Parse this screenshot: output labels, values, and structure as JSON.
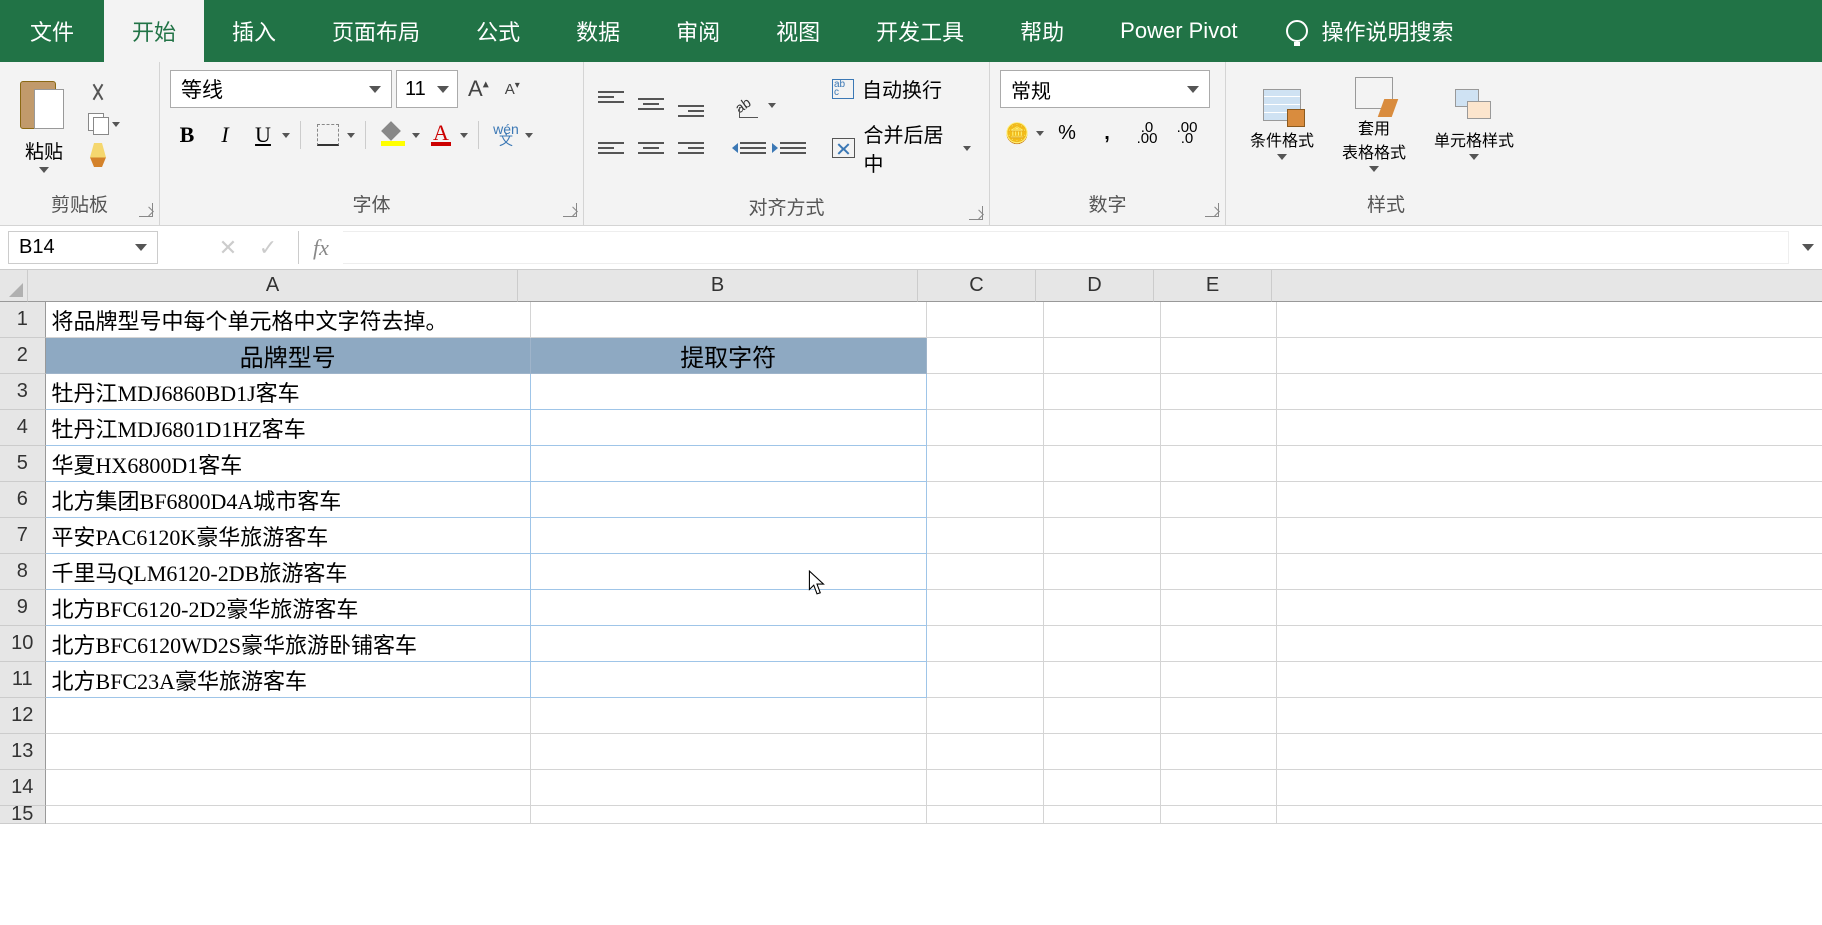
{
  "tabs": {
    "file": "文件",
    "home": "开始",
    "insert": "插入",
    "layout": "页面布局",
    "formulas": "公式",
    "data": "数据",
    "review": "审阅",
    "view": "视图",
    "dev": "开发工具",
    "help": "帮助",
    "pivot": "Power Pivot",
    "tellme": "操作说明搜索"
  },
  "ribbon": {
    "clipboard": {
      "label": "剪贴板",
      "paste": "粘贴"
    },
    "font": {
      "label": "字体",
      "name": "等线",
      "size": "11",
      "pinyin_top": "wén",
      "pinyin_bot": "文"
    },
    "align": {
      "label": "对齐方式",
      "wrap": "自动换行",
      "merge": "合并后居中"
    },
    "number": {
      "label": "数字",
      "format": "常规",
      "dec_inc": ".0\n.00",
      "dec_dec": ".00\n.0"
    },
    "styles": {
      "label": "样式",
      "cf": "条件格式",
      "ft": "套用\n表格格式",
      "cs": "单元格样式"
    }
  },
  "fbar": {
    "name": "B14",
    "fx": "fx"
  },
  "grid": {
    "cols": [
      "A",
      "B",
      "C",
      "D",
      "E",
      ""
    ],
    "row1": "将品牌型号中每个单元格中文字符去掉。",
    "h1": "品牌型号",
    "h2": "提取字符",
    "data": [
      "牡丹江MDJ6860BD1J客车",
      "牡丹江MDJ6801D1HZ客车",
      "华夏HX6800D1客车",
      "北方集团BF6800D4A城市客车",
      "平安PAC6120K豪华旅游客车",
      "千里马QLM6120-2DB旅游客车",
      "北方BFC6120-2D2豪华旅游客车",
      "北方BFC6120WD2S豪华旅游卧铺客车",
      "北方BFC23A豪华旅游客车"
    ]
  }
}
